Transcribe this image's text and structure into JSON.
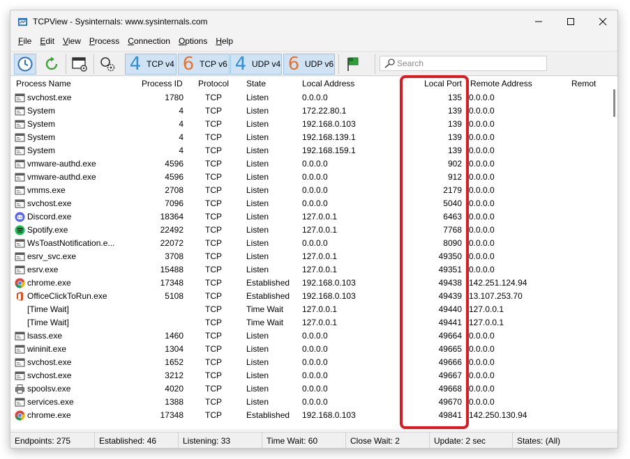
{
  "window": {
    "title": "TCPView - Sysinternals: www.sysinternals.com"
  },
  "menu": [
    {
      "key": "F",
      "rest": "ile"
    },
    {
      "key": "E",
      "rest": "dit"
    },
    {
      "key": "V",
      "rest": "iew"
    },
    {
      "key": "P",
      "rest": "rocess"
    },
    {
      "key": "C",
      "rest": "onnection"
    },
    {
      "key": "O",
      "rest": "ptions"
    },
    {
      "key": "H",
      "rest": "elp"
    }
  ],
  "toolbar": {
    "filters": [
      {
        "num": "4",
        "label": "TCP v4",
        "num_color": "#2f8fd8"
      },
      {
        "num": "6",
        "label": "TCP v6",
        "num_color": "#e8742b"
      },
      {
        "num": "4",
        "label": "UDP v4",
        "num_color": "#2f8fd8"
      },
      {
        "num": "6",
        "label": "UDP v6",
        "num_color": "#e8742b"
      }
    ],
    "search_placeholder": "Search"
  },
  "columns": {
    "process_name": "Process Name",
    "process_id": "Process ID",
    "protocol": "Protocol",
    "state": "State",
    "local_address": "Local Address",
    "local_port": "Local Port",
    "remote_address": "Remote Address",
    "remote_port": "Remot"
  },
  "rows": [
    {
      "name": "svchost.exe",
      "pid": "1780",
      "proto": "TCP",
      "state": "Listen",
      "laddr": "0.0.0.0",
      "lport": "135",
      "raddr": "0.0.0.0",
      "icon": "window-app-icon"
    },
    {
      "name": "System",
      "pid": "4",
      "proto": "TCP",
      "state": "Listen",
      "laddr": "172.22.80.1",
      "lport": "139",
      "raddr": "0.0.0.0",
      "icon": "window-app-icon"
    },
    {
      "name": "System",
      "pid": "4",
      "proto": "TCP",
      "state": "Listen",
      "laddr": "192.168.0.103",
      "lport": "139",
      "raddr": "0.0.0.0",
      "icon": "window-app-icon"
    },
    {
      "name": "System",
      "pid": "4",
      "proto": "TCP",
      "state": "Listen",
      "laddr": "192.168.139.1",
      "lport": "139",
      "raddr": "0.0.0.0",
      "icon": "window-app-icon"
    },
    {
      "name": "System",
      "pid": "4",
      "proto": "TCP",
      "state": "Listen",
      "laddr": "192.168.159.1",
      "lport": "139",
      "raddr": "0.0.0.0",
      "icon": "window-app-icon"
    },
    {
      "name": "vmware-authd.exe",
      "pid": "4596",
      "proto": "TCP",
      "state": "Listen",
      "laddr": "0.0.0.0",
      "lport": "902",
      "raddr": "0.0.0.0",
      "icon": "window-app-icon"
    },
    {
      "name": "vmware-authd.exe",
      "pid": "4596",
      "proto": "TCP",
      "state": "Listen",
      "laddr": "0.0.0.0",
      "lport": "912",
      "raddr": "0.0.0.0",
      "icon": "window-app-icon"
    },
    {
      "name": "vmms.exe",
      "pid": "2708",
      "proto": "TCP",
      "state": "Listen",
      "laddr": "0.0.0.0",
      "lport": "2179",
      "raddr": "0.0.0.0",
      "icon": "window-app-icon"
    },
    {
      "name": "svchost.exe",
      "pid": "7096",
      "proto": "TCP",
      "state": "Listen",
      "laddr": "0.0.0.0",
      "lport": "5040",
      "raddr": "0.0.0.0",
      "icon": "window-app-icon"
    },
    {
      "name": "Discord.exe",
      "pid": "18364",
      "proto": "TCP",
      "state": "Listen",
      "laddr": "127.0.0.1",
      "lport": "6463",
      "raddr": "0.0.0.0",
      "icon": "discord-icon"
    },
    {
      "name": "Spotify.exe",
      "pid": "22492",
      "proto": "TCP",
      "state": "Listen",
      "laddr": "127.0.0.1",
      "lport": "7768",
      "raddr": "0.0.0.0",
      "icon": "spotify-icon"
    },
    {
      "name": "WsToastNotification.e...",
      "pid": "22072",
      "proto": "TCP",
      "state": "Listen",
      "laddr": "0.0.0.0",
      "lport": "8090",
      "raddr": "0.0.0.0",
      "icon": "window-app-icon"
    },
    {
      "name": "esrv_svc.exe",
      "pid": "3708",
      "proto": "TCP",
      "state": "Listen",
      "laddr": "127.0.0.1",
      "lport": "49350",
      "raddr": "0.0.0.0",
      "icon": "window-app-icon"
    },
    {
      "name": "esrv.exe",
      "pid": "15488",
      "proto": "TCP",
      "state": "Listen",
      "laddr": "127.0.0.1",
      "lport": "49351",
      "raddr": "0.0.0.0",
      "icon": "window-app-icon"
    },
    {
      "name": "chrome.exe",
      "pid": "17348",
      "proto": "TCP",
      "state": "Established",
      "laddr": "192.168.0.103",
      "lport": "49438",
      "raddr": "142.251.124.94",
      "icon": "chrome-icon"
    },
    {
      "name": "OfficeClickToRun.exe",
      "pid": "5108",
      "proto": "TCP",
      "state": "Established",
      "laddr": "192.168.0.103",
      "lport": "49439",
      "raddr": "13.107.253.70",
      "icon": "office-icon"
    },
    {
      "name": "[Time Wait]",
      "pid": "",
      "proto": "TCP",
      "state": "Time Wait",
      "laddr": "127.0.0.1",
      "lport": "49440",
      "raddr": "127.0.0.1",
      "icon": ""
    },
    {
      "name": "[Time Wait]",
      "pid": "",
      "proto": "TCP",
      "state": "Time Wait",
      "laddr": "127.0.0.1",
      "lport": "49441",
      "raddr": "127.0.0.1",
      "icon": ""
    },
    {
      "name": "lsass.exe",
      "pid": "1460",
      "proto": "TCP",
      "state": "Listen",
      "laddr": "0.0.0.0",
      "lport": "49664",
      "raddr": "0.0.0.0",
      "icon": "window-app-icon"
    },
    {
      "name": "wininit.exe",
      "pid": "1304",
      "proto": "TCP",
      "state": "Listen",
      "laddr": "0.0.0.0",
      "lport": "49665",
      "raddr": "0.0.0.0",
      "icon": "window-app-icon"
    },
    {
      "name": "svchost.exe",
      "pid": "1652",
      "proto": "TCP",
      "state": "Listen",
      "laddr": "0.0.0.0",
      "lport": "49666",
      "raddr": "0.0.0.0",
      "icon": "window-app-icon"
    },
    {
      "name": "svchost.exe",
      "pid": "3212",
      "proto": "TCP",
      "state": "Listen",
      "laddr": "0.0.0.0",
      "lport": "49667",
      "raddr": "0.0.0.0",
      "icon": "window-app-icon"
    },
    {
      "name": "spoolsv.exe",
      "pid": "4020",
      "proto": "TCP",
      "state": "Listen",
      "laddr": "0.0.0.0",
      "lport": "49668",
      "raddr": "0.0.0.0",
      "icon": "printer-icon"
    },
    {
      "name": "services.exe",
      "pid": "1388",
      "proto": "TCP",
      "state": "Listen",
      "laddr": "0.0.0.0",
      "lport": "49670",
      "raddr": "0.0.0.0",
      "icon": "window-app-icon"
    },
    {
      "name": "chrome.exe",
      "pid": "17348",
      "proto": "TCP",
      "state": "Established",
      "laddr": "192.168.0.103",
      "lport": "49841",
      "raddr": "142.250.130.94",
      "icon": "chrome-icon"
    }
  ],
  "status": {
    "endpoints": "Endpoints: 275",
    "established": "Established: 46",
    "listening": "Listening: 33",
    "time_wait": "Time Wait: 60",
    "close_wait": "Close Wait: 2",
    "update": "Update: 2 sec",
    "states": "States: (All)"
  },
  "colors": {
    "highlight": "#e0191f",
    "filter_active_bg": "#cfe3f5"
  }
}
